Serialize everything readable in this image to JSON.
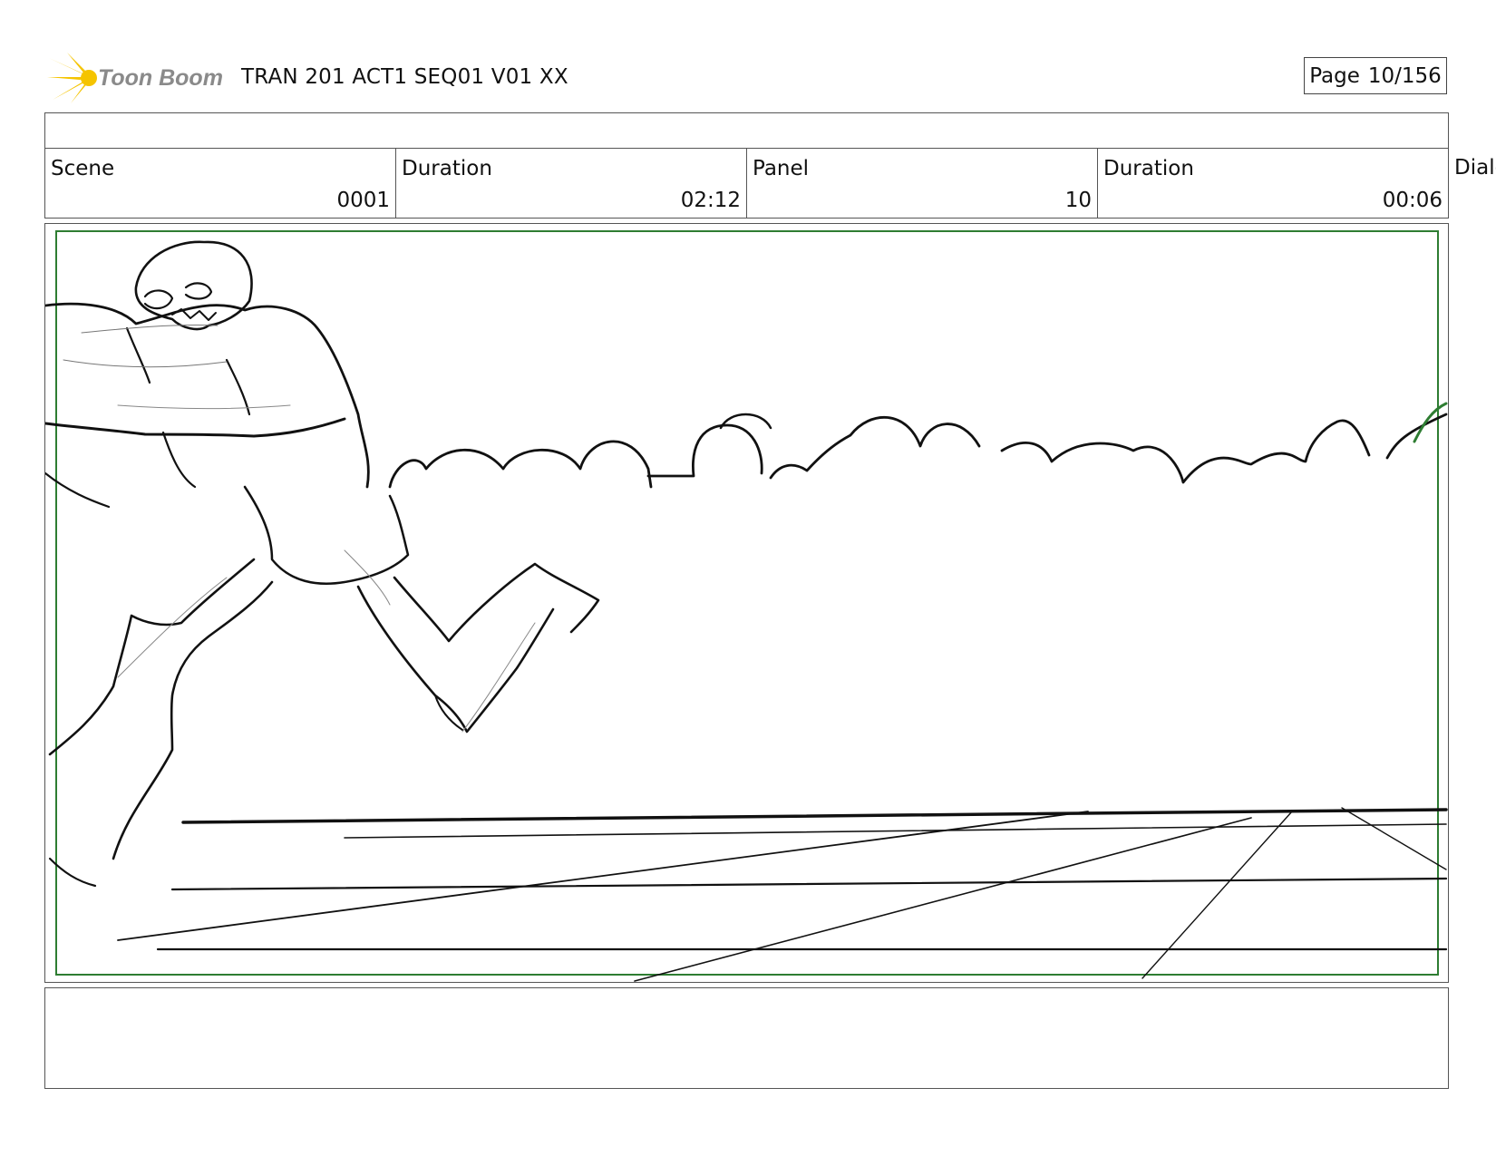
{
  "header": {
    "logo_text": "Toon Boom",
    "doc_title": "TRAN 201 ACT1 SEQ01 V01 XX",
    "page_label": "Page",
    "page_value": "10/156"
  },
  "info": {
    "scene_label": "Scene",
    "scene_value": "0001",
    "scene_duration_label": "Duration",
    "scene_duration_value": "02:12",
    "panel_label": "Panel",
    "panel_value": "10",
    "panel_duration_label": "Duration",
    "panel_duration_value": "00:06",
    "dialog_label": "Dialo"
  },
  "colors": {
    "logo_burst": "#f5c400",
    "logo_text": "#8a8a8a",
    "safe_frame": "#2e7d32",
    "border": "#555555"
  },
  "icons": {
    "logo": "toon-boom-logo-icon"
  }
}
